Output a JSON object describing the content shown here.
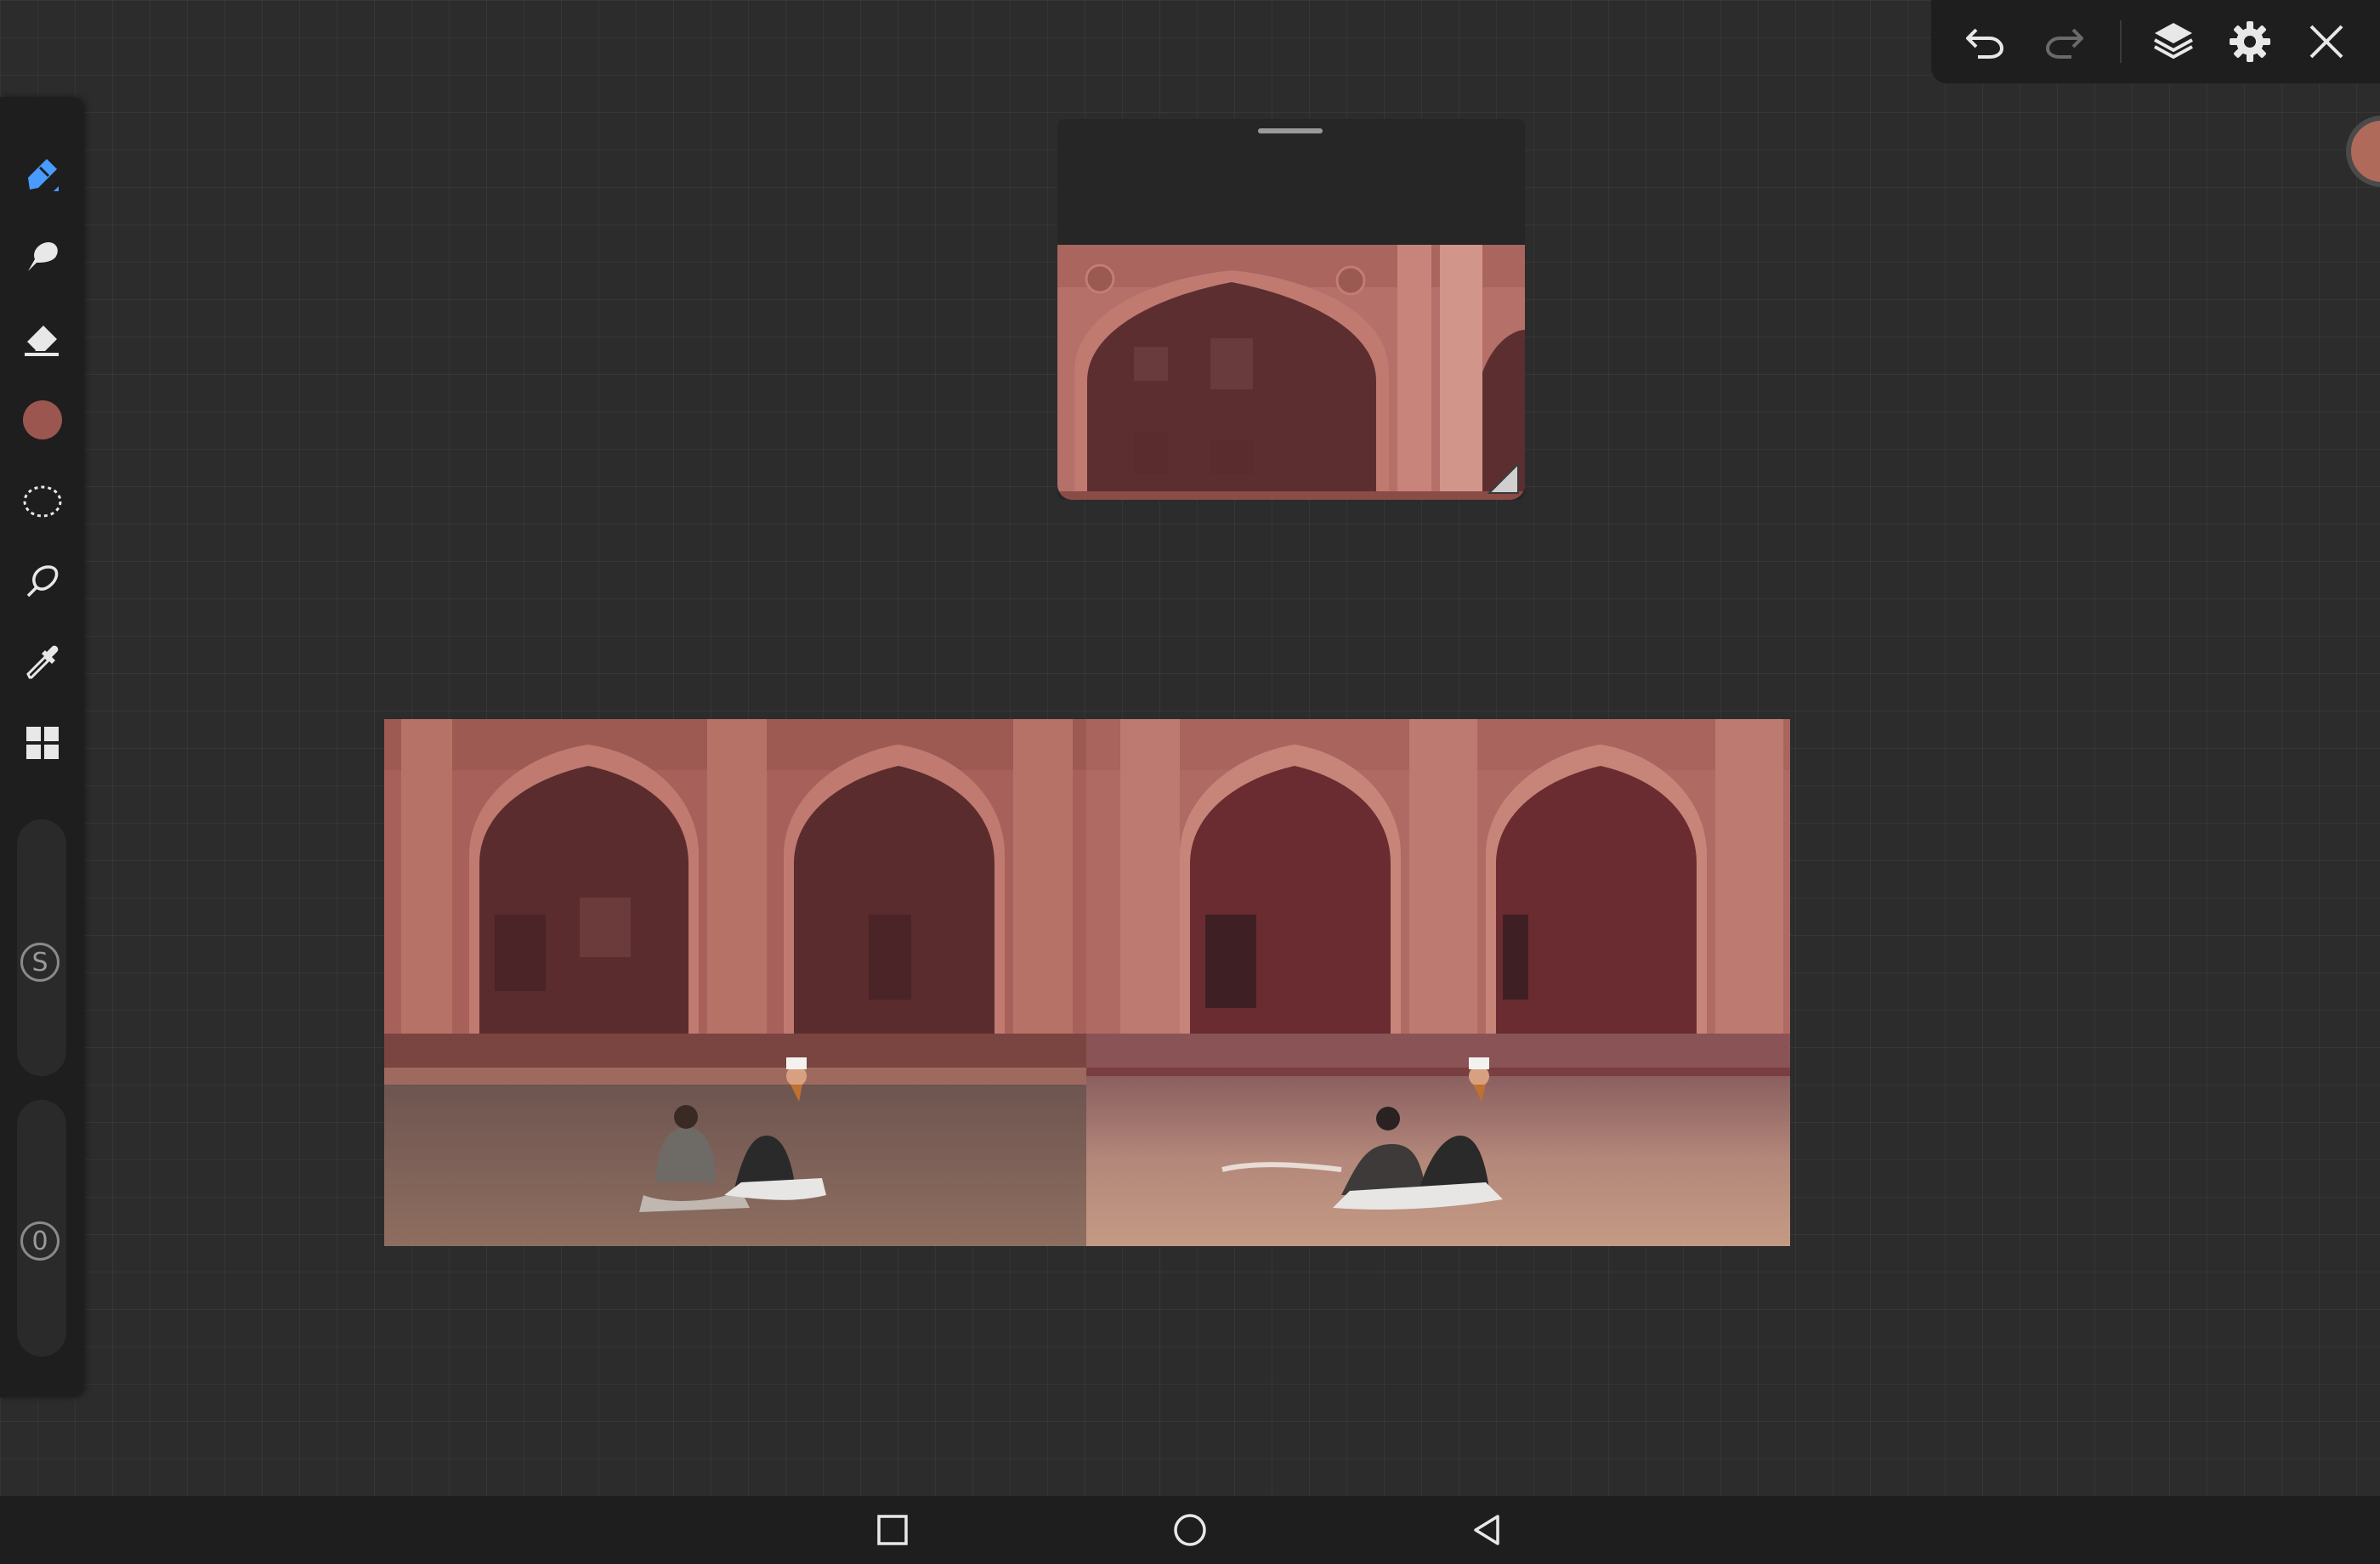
{
  "toolbar_left": {
    "tools": [
      {
        "name": "brush-tool",
        "icon": "brush-icon",
        "active": true
      },
      {
        "name": "smudge-tool",
        "icon": "smudge-icon",
        "active": false
      },
      {
        "name": "eraser-tool",
        "icon": "eraser-icon",
        "active": false
      },
      {
        "name": "color-picker",
        "icon": "color-swatch",
        "active": false
      },
      {
        "name": "lasso-select-tool",
        "icon": "lasso-icon",
        "active": false
      },
      {
        "name": "freeform-select-tool",
        "icon": "freeform-icon",
        "active": false
      },
      {
        "name": "eyedropper-tool",
        "icon": "eyedropper-icon",
        "active": false
      },
      {
        "name": "gallery-tool",
        "icon": "grid-icon",
        "active": false
      }
    ],
    "current_color": "#9c5650",
    "accent_color": "#4a9bff",
    "size_slider": {
      "label": "S"
    },
    "opacity_slider": {
      "label": "0"
    }
  },
  "toolbar_top": {
    "buttons": [
      "undo-icon",
      "redo-icon",
      "layers-icon",
      "settings-icon",
      "close-icon"
    ],
    "redo_enabled": false
  },
  "reference_panel": {
    "image": "mosque-arch-reference"
  },
  "canvas": {
    "left_image": "mosque-courtyard-photo",
    "right_image": "mosque-courtyard-painting"
  },
  "navbar": {
    "buttons": [
      "recents-icon",
      "home-icon",
      "back-icon"
    ]
  }
}
